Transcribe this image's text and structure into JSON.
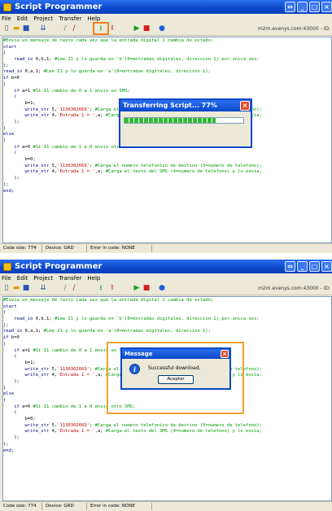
{
  "app": {
    "title": "Script Programmer"
  },
  "menu": [
    "File",
    "Edit",
    "Project",
    "Transfer",
    "Help"
  ],
  "connection": "m2m.evenys.com:43000 - ID:",
  "code_lines": [
    [
      [
        "#Envia un mensaje de texto cada vez que la entrada digital 1 cambia de estado;",
        "#009900"
      ]
    ],
    [
      [
        "start",
        "#000080"
      ]
    ],
    [
      [
        "(",
        "#000000"
      ]
    ],
    [
      [
        "    ",
        ""
      ],
      [
        "read_io",
        "#000080"
      ],
      [
        " 0,b,1; ",
        "#000000"
      ],
      [
        "#Lee I1 y lo guarda en 'b'(0=entradas digitales, direccion 1) por unica vez;",
        "#009900"
      ]
    ],
    [
      [
        ");",
        "#000000"
      ]
    ],
    [
      [
        "read_io",
        "#000080"
      ],
      [
        " 0,a,1; ",
        "#000000"
      ],
      [
        "#Lee I1 y lo guarda en 'a'(0=entradas digitales, direccion 1);",
        "#009900"
      ]
    ],
    [
      [
        "if",
        "#000080"
      ],
      [
        " b=0",
        "#000000"
      ]
    ],
    [
      [
        "(",
        "#000000"
      ]
    ],
    [
      [
        "    ",
        ""
      ],
      [
        "if",
        "#000080"
      ],
      [
        " a=1 ",
        "#000000"
      ],
      [
        "#Si I1 cambio de 0 a 1 envio un SMS;",
        "#009900"
      ]
    ],
    [
      [
        "    (",
        "#000000"
      ]
    ],
    [
      [
        "        b=1;",
        "#000000"
      ]
    ],
    [
      [
        "        ",
        ""
      ],
      [
        "write_str",
        "#000080"
      ],
      [
        " 5,",
        "#000000"
      ],
      [
        "'1136302669'",
        "#cc0000"
      ],
      [
        "; ",
        "#000000"
      ],
      [
        "#Carga el numero telefonico de destino (5=numero de telefono);",
        "#009900"
      ]
    ],
    [
      [
        "        ",
        ""
      ],
      [
        "write_str",
        "#000080"
      ],
      [
        " 4,",
        "#000000"
      ],
      [
        "'Entrada 1 = '",
        "#cc0000"
      ],
      [
        ",a; ",
        "#000000"
      ],
      [
        "#Carga el texto del SMS (4=numero de telefono) y lo envia;",
        "#009900"
      ]
    ],
    [
      [
        "    );",
        "#000000"
      ]
    ],
    [
      [
        ")",
        "#000000"
      ]
    ],
    [
      [
        "else",
        "#000080"
      ]
    ],
    [
      [
        "(",
        "#000000"
      ]
    ],
    [
      [
        "    ",
        ""
      ],
      [
        "if",
        "#000080"
      ],
      [
        " a=0 ",
        "#000000"
      ],
      [
        "#Si I1 cambio de 1 a 0 envio otro SMS;",
        "#009900"
      ]
    ],
    [
      [
        "    (",
        "#000000"
      ]
    ],
    [
      [
        "        b=0;",
        "#000000"
      ]
    ],
    [
      [
        "        ",
        ""
      ],
      [
        "write_str",
        "#000080"
      ],
      [
        " 5,",
        "#000000"
      ],
      [
        "'1136302669'",
        "#cc0000"
      ],
      [
        "; ",
        "#000000"
      ],
      [
        "#Carga el numero telefonico de destino (5=numero de telefono);",
        "#009900"
      ]
    ],
    [
      [
        "        ",
        ""
      ],
      [
        "write_str",
        "#000080"
      ],
      [
        " 4,",
        "#000000"
      ],
      [
        "'Entrada 1 = '",
        "#cc0000"
      ],
      [
        ",a; ",
        "#000000"
      ],
      [
        "#Carga el texto del SMS (4=numero de telefono) y lo envia;",
        "#009900"
      ]
    ],
    [
      [
        "    );",
        "#000000"
      ]
    ],
    [
      [
        ");",
        "#000000"
      ]
    ],
    [
      [
        "end;",
        "#000080"
      ]
    ]
  ],
  "status": {
    "code_size": "Code size: 774",
    "device": "Device: GRD",
    "error": "Error in code: NONE"
  },
  "transfer_dialog": {
    "title": "Transferring Script... 77%",
    "progress": 0.77
  },
  "message_dialog": {
    "title": "Message",
    "text": "Successful download.",
    "button": "Aceptar"
  },
  "colors": {
    "comment": "#009900",
    "keyword": "#000080",
    "string": "#cc0000",
    "titlebar": "#0a47c8",
    "highlight": "#f58020"
  },
  "icons": [
    "new-file-icon",
    "open-folder-icon",
    "save-icon",
    "compile-icon",
    "check-icon",
    "erase-icon",
    "download-icon",
    "upload-icon",
    "run-icon",
    "stop-icon",
    "help-icon"
  ]
}
